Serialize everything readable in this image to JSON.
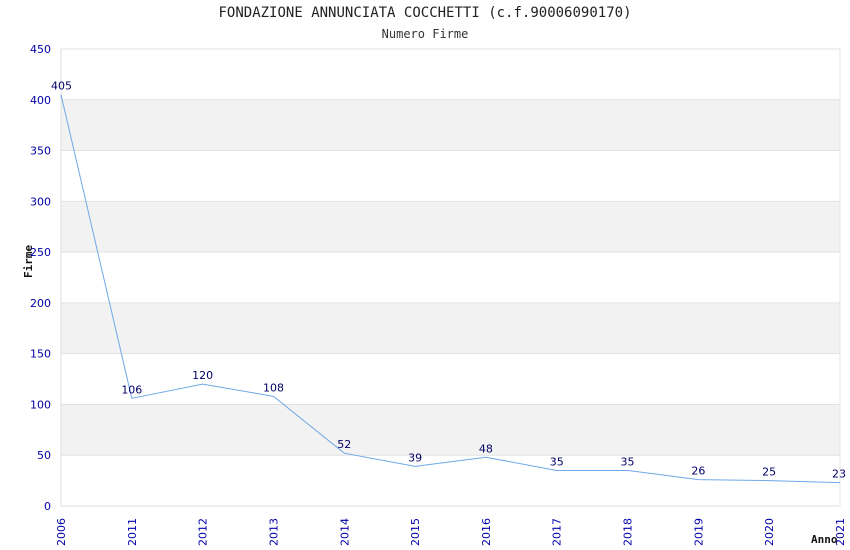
{
  "chart_data": {
    "type": "line",
    "title": "FONDAZIONE ANNUNCIATA COCCHETTI (c.f.90006090170)",
    "subtitle": "Numero Firme",
    "xlabel": "Anno",
    "ylabel": "Firme",
    "categories": [
      "2006",
      "2011",
      "2012",
      "2013",
      "2014",
      "2015",
      "2016",
      "2017",
      "2018",
      "2019",
      "2020",
      "2021"
    ],
    "series": [
      {
        "values": [
          405,
          106,
          120,
          108,
          52,
          39,
          48,
          35,
          35,
          26,
          25,
          23
        ]
      }
    ],
    "ylim": [
      0,
      450
    ],
    "yticks": [
      0,
      50,
      100,
      150,
      200,
      250,
      300,
      350,
      400,
      450
    ],
    "grid": true,
    "line_color": "#6fa8e8",
    "band_color": "#f2f2f2",
    "tick_color": "#0000aa"
  }
}
